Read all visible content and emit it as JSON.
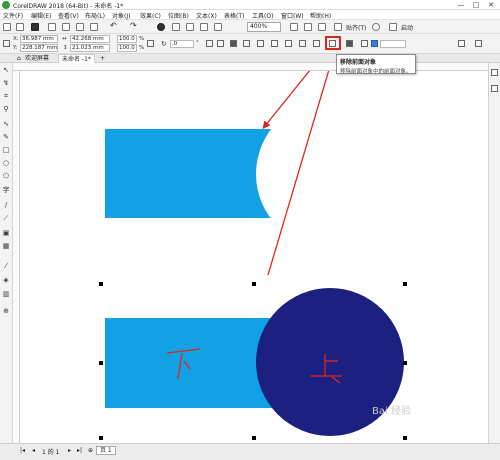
{
  "window": {
    "title": "CorelDRAW 2018 (64-Bit) - 未命名 -1*",
    "minimize": "—",
    "maximize": "□",
    "close": "✕"
  },
  "menu": [
    "文件(F)",
    "编辑(E)",
    "查看(V)",
    "布局(L)",
    "对象(J)",
    "效果(C)",
    "位图(B)",
    "文本(X)",
    "表格(T)",
    "工具(O)",
    "窗口(W)",
    "帮助(H)"
  ],
  "toolbar": {
    "zoom": "400%",
    "paste_label": "贴齐(T)",
    "launch_label": "启动"
  },
  "properties": {
    "x_label": "X:",
    "x_value": "36.987 mm",
    "y_label": "Y:",
    "y_value": "228.187 mm",
    "width": "42.268 mm",
    "height": "21.023 mm",
    "scale_w": "100.0",
    "scale_h": "100.0",
    "percent": "%",
    "rotation": ".0",
    "degree": "°"
  },
  "tabs": {
    "welcome": "欢迎屏幕",
    "doc": "未命名 -1*",
    "add": "+"
  },
  "tooltip": {
    "title": "移除前面对象",
    "description": "移除前面对象中的前面对象。"
  },
  "canvas": {
    "label_below": "下",
    "label_above": "上",
    "colors": {
      "rect": "#12a1e5",
      "circle": "#1c2081",
      "annotation": "#e0261b"
    }
  },
  "status": {
    "page_info": "1 的 1",
    "page_tab": "页 1"
  },
  "watermark": "Bai 经验"
}
